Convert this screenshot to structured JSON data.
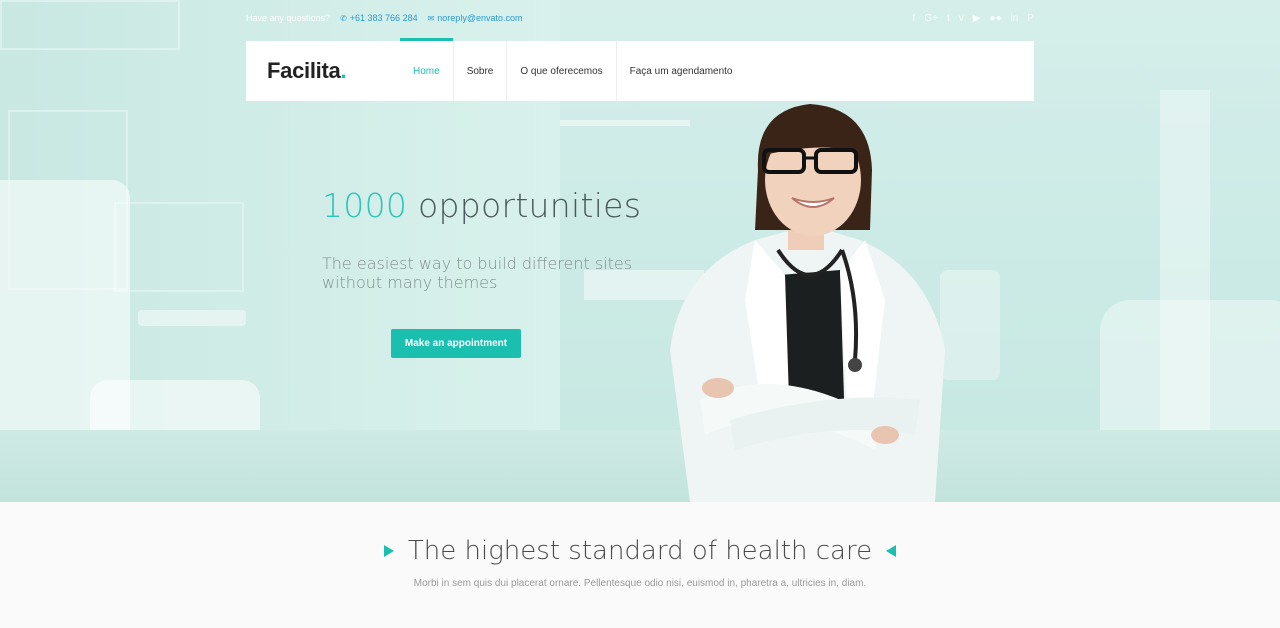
{
  "topbar": {
    "question": "Have any questions?",
    "phone": "+61 383 766 284",
    "email": "noreply@envato.com",
    "socials": [
      "f",
      "G+",
      "t",
      "v",
      "▶",
      "●●",
      "in",
      "P"
    ]
  },
  "nav": {
    "logo_main": "Facilita",
    "logo_dot": ".",
    "items": [
      {
        "label": "Home",
        "active": true
      },
      {
        "label": "Sobre",
        "active": false
      },
      {
        "label": "O que oferecemos",
        "active": false
      },
      {
        "label": "Faça um agendamento",
        "active": false
      }
    ]
  },
  "hero": {
    "headline_highlight": "1000",
    "headline_rest": " opportunities",
    "sub_line1": "The easiest way to build different sites",
    "sub_line2": "without many themes",
    "cta": "Make an appointment"
  },
  "section": {
    "title": "The highest standard of health care",
    "text": "Morbi in sem quis dui placerat ornare. Pellentesque odio nisi, euismod in, pharetra a, ultricies in, diam."
  },
  "colors": {
    "accent": "#1bbfb0",
    "link": "#2a9ad6"
  }
}
